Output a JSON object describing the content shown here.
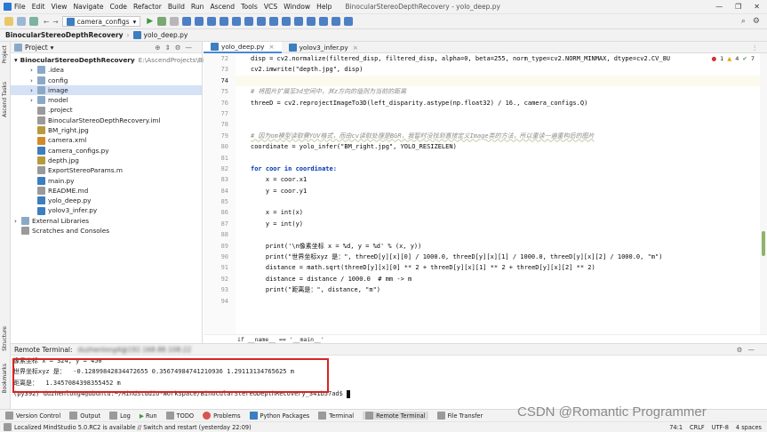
{
  "titlebar": {
    "menu": [
      "File",
      "Edit",
      "View",
      "Navigate",
      "Code",
      "Refactor",
      "Build",
      "Run",
      "Ascend",
      "Tools",
      "VCS",
      "Window",
      "Help"
    ],
    "window_title": "BinocularStereoDepthRecovery - yolo_deep.py"
  },
  "toolbar": {
    "run_config": "camera_configs"
  },
  "breadcrumb": {
    "project": "BinocularStereoDepthRecovery",
    "file": "yolo_deep.py"
  },
  "left_tool_labels": {
    "project": "Project",
    "ascend_tasks": "Ascend Tasks",
    "structure": "Structure",
    "bookmarks": "Bookmarks"
  },
  "project_panel": {
    "title": "Project",
    "root": "BinocularStereoDepthRecovery",
    "root_path": "E:\\AscendProjects\\Bi",
    "items": [
      {
        "label": ".idea",
        "kind": "folder",
        "depth": 1
      },
      {
        "label": "config",
        "kind": "folder",
        "depth": 1
      },
      {
        "label": "image",
        "kind": "folder",
        "depth": 1
      },
      {
        "label": "model",
        "kind": "folder",
        "depth": 1
      },
      {
        "label": ".project",
        "kind": "gen",
        "depth": 1
      },
      {
        "label": "BinocularStereoDepthRecovery.iml",
        "kind": "gen",
        "depth": 1
      },
      {
        "label": "BM_right.jpg",
        "kind": "img",
        "depth": 1
      },
      {
        "label": "camera.xml",
        "kind": "xml",
        "depth": 1
      },
      {
        "label": "camera_configs.py",
        "kind": "py",
        "depth": 1
      },
      {
        "label": "depth.jpg",
        "kind": "img",
        "depth": 1
      },
      {
        "label": "ExportStereoParams.m",
        "kind": "gen",
        "depth": 1
      },
      {
        "label": "main.py",
        "kind": "py",
        "depth": 1
      },
      {
        "label": "README.md",
        "kind": "gen",
        "depth": 1
      },
      {
        "label": "yolo_deep.py",
        "kind": "py",
        "depth": 1
      },
      {
        "label": "yolov3_infer.py",
        "kind": "py",
        "depth": 1
      },
      {
        "label": "External Libraries",
        "kind": "lib",
        "depth": 0
      },
      {
        "label": "Scratches and Consoles",
        "kind": "gen",
        "depth": 0
      }
    ]
  },
  "editor": {
    "tabs": [
      {
        "label": "yolo_deep.py"
      },
      {
        "label": "yolov3_infer.py"
      }
    ],
    "inspections": {
      "errors": "1",
      "warnings": "4",
      "weak": "7"
    },
    "line_numbers": [
      "72",
      "73",
      "74",
      "75",
      "76",
      "77",
      "78",
      "79",
      "80",
      "81",
      "82",
      "83",
      "84",
      "85",
      "86",
      "87",
      "88",
      "89",
      "90",
      "91",
      "92",
      "93",
      "94"
    ],
    "code": {
      "l72": "disp = cv2.normalize(filtered_disp, filtered_disp, alpha=0, beta=255, norm_type=cv2.NORM_MINMAX, dtype=cv2.CV_8U",
      "l73": "cv2.imwrite(\"depth.jpg\", disp)",
      "l74": "",
      "l75": "# 将图片扩展至3d空间中，其z方向的值则为当前的距离",
      "l76": "threeD = cv2.reprojectImageTo3D(left_disparity.astype(np.float32) / 16., camera_configs.Q)",
      "l77": "",
      "l78": "",
      "l79": "# 因为om模型读取需YUV格式，而由cv读取处理是BGR，我暂时没找到直接定义Image类的方法，所以重读一遍重构后的图片",
      "l80": "coordinate = yolo_infer(\"BM_right.jpg\", YOLO_RESIZELEN)",
      "l81": "",
      "l82": "for coor in coordinate:",
      "l83": "    x = coor.x1",
      "l84": "    y = coor.y1",
      "l85": "",
      "l86": "    x = int(x)",
      "l87": "    y = int(y)",
      "l88": "",
      "l89": "    print('\\n像素坐标 x = %d, y = %d' % (x, y))",
      "l90": "    print(\"世界坐标xyz 是：\", threeD[y][x][0] / 1000.0, threeD[y][x][1] / 1000.0, threeD[y][x][2] / 1000.0, \"m\")",
      "l91": "    distance = math.sqrt(threeD[y][x][0] ** 2 + threeD[y][x][1] ** 2 + threeD[y][x][2] ** 2)",
      "l92": "    distance = distance / 1000.0  # mm -> m",
      "l93": "    print(\"距离是：\", distance, \"m\")",
      "l94": ""
    },
    "breadcrumb_bottom": "if __name__ == '__main__'"
  },
  "terminal": {
    "title": "Remote Terminal:",
    "host_blurred": "duzhenlong4@192.168.88.108:22",
    "lines": [
      "像素坐标 x = 324, y = 450",
      "世界坐标xyz 是：  -0.12899842834472655 0.35674984741210936 1.29113134765625 m",
      "距离是：  1.3457084398355452 m",
      "(py392) duzhenlong4@ubuntu:~/MindStudio-WorkSpace/BinocularStereoDepthRecovery_341b57ad$ "
    ]
  },
  "bottom_tools": [
    "Version Control",
    "TODO",
    "Log",
    "Run",
    "TODO",
    "Problems",
    "Python Packages",
    "Terminal",
    "Remote Terminal",
    "File Transfer"
  ],
  "status": {
    "message": "Localized MindStudio 5.0.RC2 is available // Switch and restart (yesterday 22:09)",
    "position": "74:1",
    "line_sep": "CRLF",
    "encoding": "UTF-8",
    "indent": "4 spaces"
  },
  "watermark": "CSDN @Romantic Programmer"
}
